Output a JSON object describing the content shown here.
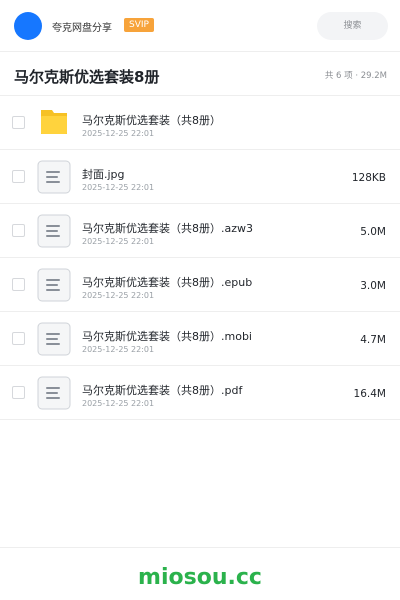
{
  "header": {
    "app_name": "夸克网盘分享",
    "svip_label": "SVIP",
    "search_label": "搜索",
    "avatar_color": "#1677ff",
    "svip_color": "#f7a33a"
  },
  "page": {
    "title": "马尔克斯优选套装8册",
    "summary": "共 6 项 · 29.2M"
  },
  "files": [
    {
      "name": "马尔克斯优选套装（共8册）",
      "date": "2025-12-25 22:01",
      "size": "",
      "icon": "folder-icon"
    },
    {
      "name": "封面.jpg",
      "date": "2025-12-25 22:01",
      "size": "128KB",
      "icon": "document-icon"
    },
    {
      "name": "马尔克斯优选套装（共8册）.azw3",
      "date": "2025-12-25 22:01",
      "size": "5.0M",
      "icon": "document-icon"
    },
    {
      "name": "马尔克斯优选套装（共8册）.epub",
      "date": "2025-12-25 22:01",
      "size": "3.0M",
      "icon": "document-icon"
    },
    {
      "name": "马尔克斯优选套装（共8册）.mobi",
      "date": "2025-12-25 22:01",
      "size": "4.7M",
      "icon": "document-icon"
    },
    {
      "name": "马尔克斯优选套装（共8册）.pdf",
      "date": "2025-12-25 22:01",
      "size": "16.4M",
      "icon": "document-icon"
    }
  ],
  "footer": {
    "watermark": "miosou.cc",
    "watermark_color": "#2bb24c"
  }
}
